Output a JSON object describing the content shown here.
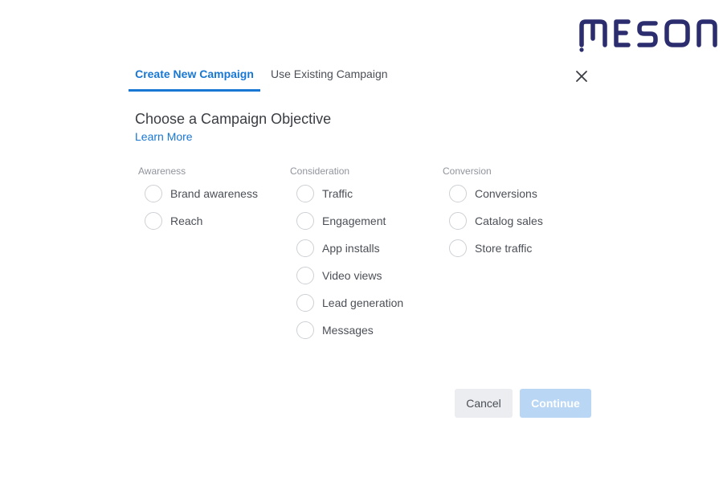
{
  "brand": {
    "logo_text": "MESON",
    "color": "#2b2d6e"
  },
  "tabs": [
    {
      "label": "Create New Campaign",
      "active": true
    },
    {
      "label": "Use Existing Campaign",
      "active": false
    }
  ],
  "close_icon": "close-icon",
  "heading": {
    "title": "Choose a Campaign Objective",
    "learn_more": "Learn More"
  },
  "objectives": {
    "awareness": {
      "header": "Awareness",
      "options": [
        "Brand awareness",
        "Reach"
      ]
    },
    "consideration": {
      "header": "Consideration",
      "options": [
        "Traffic",
        "Engagement",
        "App installs",
        "Video views",
        "Lead generation",
        "Messages"
      ]
    },
    "conversion": {
      "header": "Conversion",
      "options": [
        "Conversions",
        "Catalog sales",
        "Store traffic"
      ]
    }
  },
  "actions": {
    "cancel_label": "Cancel",
    "continue_label": "Continue",
    "continue_disabled": true
  },
  "colors": {
    "accent": "#1877d3",
    "continue_disabled_bg": "#b9d7f5",
    "cancel_bg": "#ebedf0"
  }
}
